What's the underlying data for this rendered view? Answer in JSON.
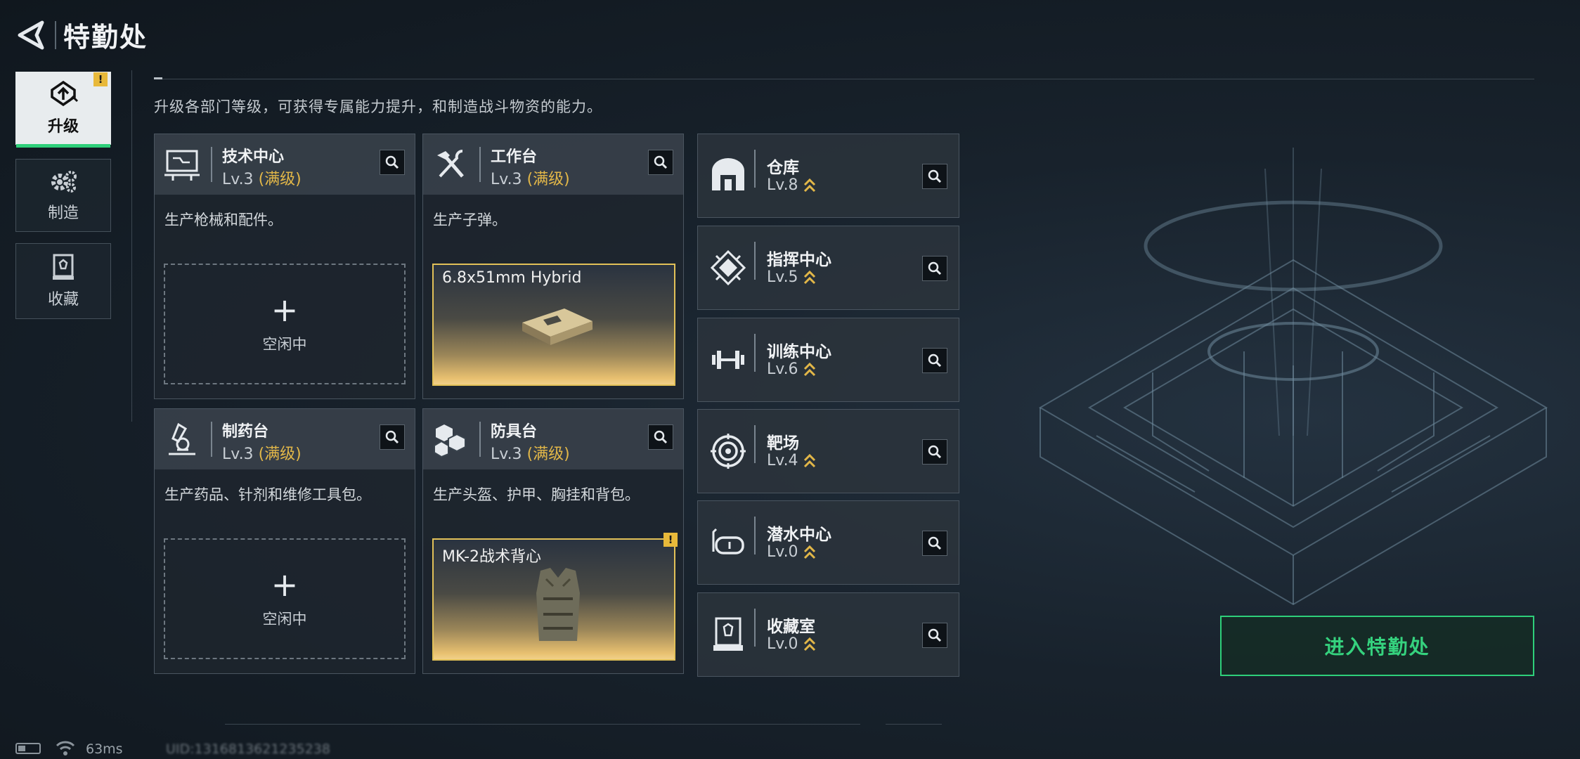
{
  "header": {
    "title": "特勤处"
  },
  "nav": [
    {
      "label": "升级",
      "icon": "upgrade-icon",
      "active": true,
      "badge": "!"
    },
    {
      "label": "制造",
      "icon": "gears-icon",
      "active": false
    },
    {
      "label": "收藏",
      "icon": "collection-icon",
      "active": false
    }
  ],
  "description": "升级各部门等级，可获得专属能力提升，和制造战斗物资的能力。",
  "cards": [
    {
      "name": "技术中心",
      "level": "Lv.3",
      "max": "(满级)",
      "desc": "生产枪械和配件。",
      "icon": "workstation-icon",
      "slot": {
        "plus": "+",
        "status": "空闲中"
      }
    },
    {
      "name": "工作台",
      "level": "Lv.3",
      "max": "(满级)",
      "desc": "生产子弹。",
      "icon": "tools-icon",
      "product": "6.8x51mm Hybrid"
    },
    {
      "name": "制药台",
      "level": "Lv.3",
      "max": "(满级)",
      "desc": "生产药品、针剂和维修工具包。",
      "icon": "microscope-icon",
      "slot": {
        "plus": "+",
        "status": "空闲中"
      }
    },
    {
      "name": "防具台",
      "level": "Lv.3",
      "max": "(满级)",
      "desc": "生产头盔、护甲、胸挂和背包。",
      "icon": "armor-blocks-icon",
      "product": "MK-2战术背心",
      "badge": "!"
    }
  ],
  "facilities": [
    {
      "name": "仓库",
      "level": "Lv.8",
      "icon": "warehouse-icon"
    },
    {
      "name": "指挥中心",
      "level": "Lv.5",
      "icon": "command-chip-icon"
    },
    {
      "name": "训练中心",
      "level": "Lv.6",
      "icon": "dumbbell-icon"
    },
    {
      "name": "靶场",
      "level": "Lv.4",
      "icon": "target-icon"
    },
    {
      "name": "潜水中心",
      "level": "Lv.0",
      "icon": "diving-mask-icon"
    },
    {
      "name": "收藏室",
      "level": "Lv.0",
      "icon": "showcase-icon"
    }
  ],
  "enter_button": "进入特勤处",
  "status": {
    "ping": "63ms",
    "uid": "UID:1316813621235238"
  },
  "colors": {
    "accent_green": "#2ecf7a",
    "gold": "#e2b748",
    "warning": "#e8b93a"
  }
}
